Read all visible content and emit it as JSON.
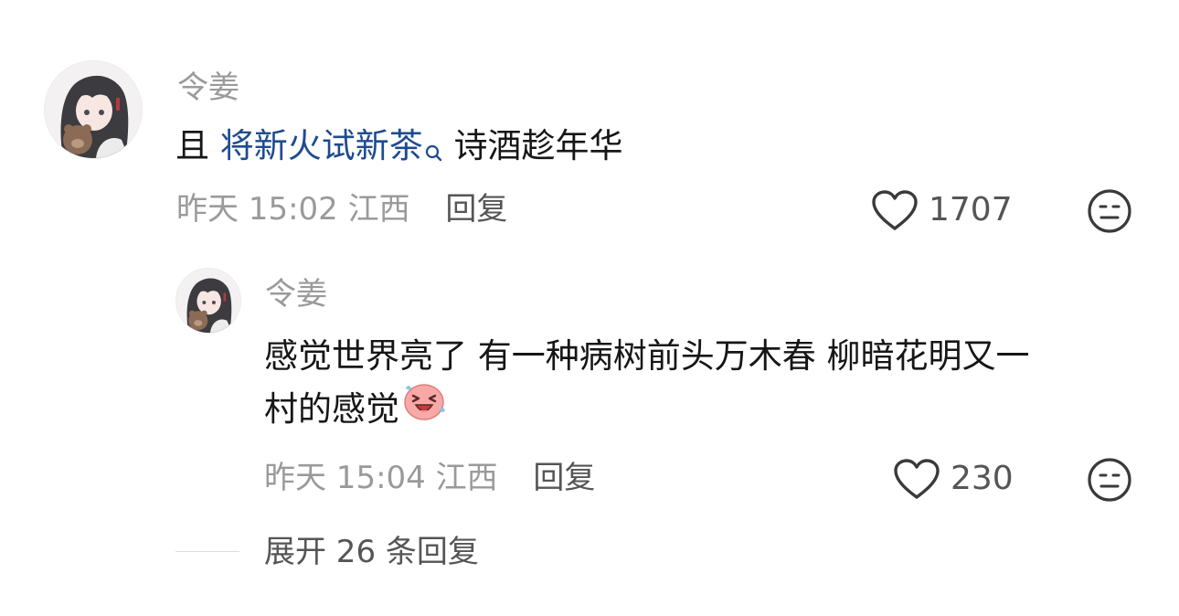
{
  "comment": {
    "username": "令姜",
    "content_prefix": "且 ",
    "content_link": "将新火试新茶",
    "content_suffix": "  诗酒趁年华",
    "time": "昨天 15:02",
    "location": "江西",
    "reply_label": "回复",
    "likes": "1707"
  },
  "reply": {
    "username": "令姜",
    "content_line1": "感觉世界亮了 有一种病树前头万木春 柳暗花明又一",
    "content_line2": "村的感觉",
    "emoji_icon": "laughing-crying-emoji-icon",
    "time": "昨天 15:04",
    "location": "江西",
    "reply_label": "回复",
    "likes": "230"
  },
  "expand_label": "展开 26 条回复",
  "icons": {
    "like": "heart-outline-icon",
    "dislike": "neutral-face-icon",
    "search": "search-icon"
  },
  "colors": {
    "link": "#1e4b8f",
    "muted": "#9a9a9a"
  }
}
